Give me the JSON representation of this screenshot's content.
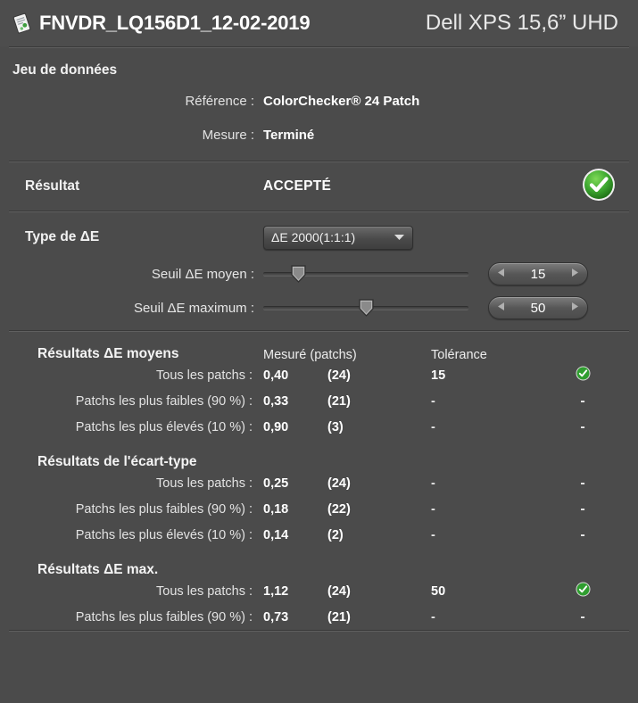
{
  "header": {
    "icon": "report-document-icon",
    "title": "FNVDR_LQ156D1_12-02-2019",
    "device": "Dell XPS 15,6” UHD"
  },
  "dataset": {
    "section_title": "Jeu de données",
    "reference_label": "Référence :",
    "reference_value": "ColorChecker® 24 Patch",
    "measure_label": "Mesure :",
    "measure_value": "Terminé"
  },
  "result": {
    "label": "Résultat",
    "verdict": "ACCEPTÉ",
    "badge_icon": "green-check-circle-icon",
    "badge_color": "#2f9e2f"
  },
  "delta_e": {
    "type_label": "Type de ΔE",
    "type_value": "ΔE 2000(1:1:1)",
    "dropdown_icon": "chevron-down-icon",
    "mean_threshold_label": "Seuil ΔE moyen :",
    "mean_threshold_value": "15",
    "mean_slider_percent": 17,
    "max_threshold_label": "Seuil ΔE maximum :",
    "max_threshold_value": "50",
    "max_slider_percent": 50,
    "spinner_left_icon": "triangle-left-icon",
    "spinner_right_icon": "triangle-right-icon"
  },
  "tables": {
    "columns": {
      "measured": "Mesuré (patchs)",
      "tolerance": "Tolérance"
    },
    "groups": [
      {
        "title": "Résultats ΔE moyens",
        "show_header": true,
        "rows": [
          {
            "label": "Tous les patchs :",
            "measured": "0,40",
            "patches": "(24)",
            "tolerance": "15",
            "status": "ok"
          },
          {
            "label": "Patchs les plus faibles (90 %) :",
            "measured": "0,33",
            "patches": "(21)",
            "tolerance": "-",
            "status": "-"
          },
          {
            "label": "Patchs les plus élevés (10 %) :",
            "measured": "0,90",
            "patches": "(3)",
            "tolerance": "-",
            "status": "-"
          }
        ]
      },
      {
        "title": "Résultats de l'écart-type",
        "show_header": false,
        "rows": [
          {
            "label": "Tous les patchs :",
            "measured": "0,25",
            "patches": "(24)",
            "tolerance": "-",
            "status": "-"
          },
          {
            "label": "Patchs les plus faibles (90 %) :",
            "measured": "0,18",
            "patches": "(22)",
            "tolerance": "-",
            "status": "-"
          },
          {
            "label": "Patchs les plus élevés (10 %) :",
            "measured": "0,14",
            "patches": "(2)",
            "tolerance": "-",
            "status": "-"
          }
        ]
      },
      {
        "title": "Résultats ΔE max.",
        "show_header": false,
        "rows": [
          {
            "label": "Tous les patchs :",
            "measured": "1,12",
            "patches": "(24)",
            "tolerance": "50",
            "status": "ok"
          },
          {
            "label": "Patchs les plus faibles (90 %) :",
            "measured": "0,73",
            "patches": "(21)",
            "tolerance": "-",
            "status": "-"
          }
        ]
      }
    ]
  },
  "theme": {
    "background": "#4b4b4b",
    "text": "#ffffff",
    "accent_green": "#2f9e2f"
  }
}
